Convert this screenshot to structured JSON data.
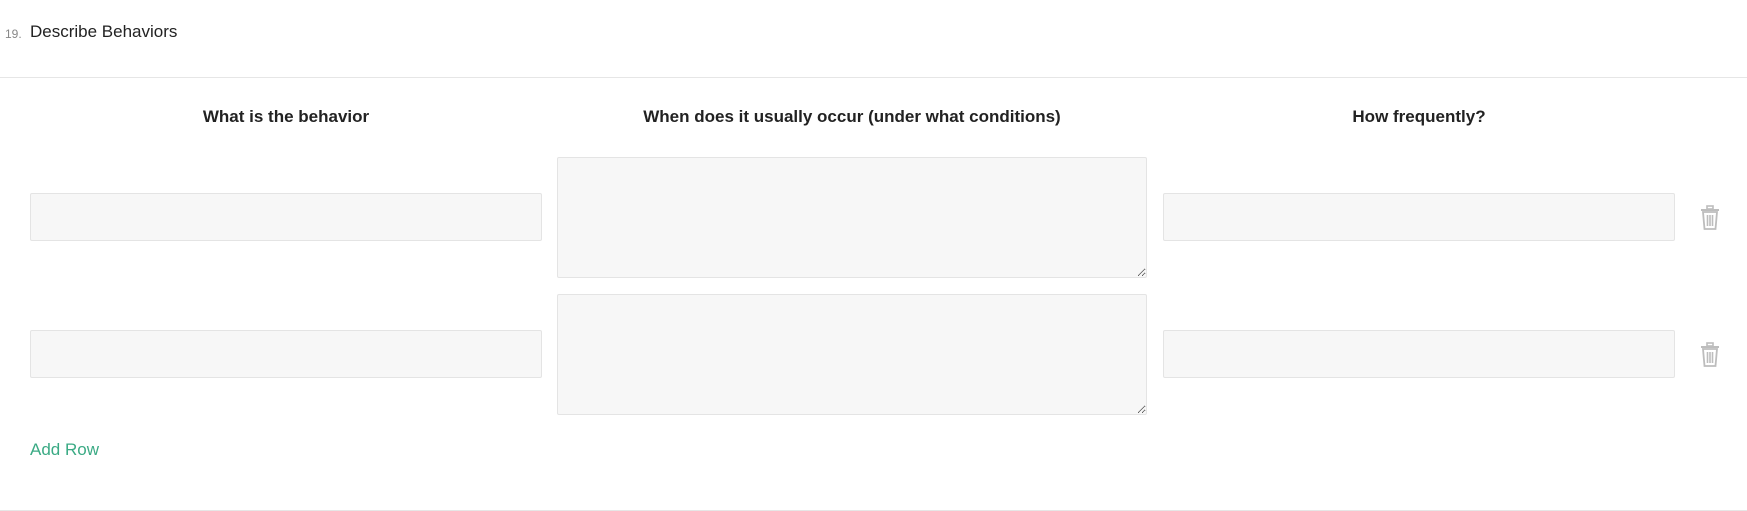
{
  "question": {
    "number": "19.",
    "title": "Describe Behaviors"
  },
  "columns": [
    "What is the behavior",
    "When does it usually occur (under what conditions)",
    "How frequently?"
  ],
  "rows": [
    {
      "behavior": "",
      "conditions": "",
      "frequency": ""
    },
    {
      "behavior": "",
      "conditions": "",
      "frequency": ""
    }
  ],
  "actions": {
    "add_row_label": "Add Row"
  },
  "icons": {
    "delete": "trash-icon"
  },
  "colors": {
    "accent": "#3aaa84",
    "icon": "#bdbdbd",
    "field_bg": "#f7f7f7",
    "field_border": "#e4e4e4",
    "divider": "#e6e6e6"
  }
}
